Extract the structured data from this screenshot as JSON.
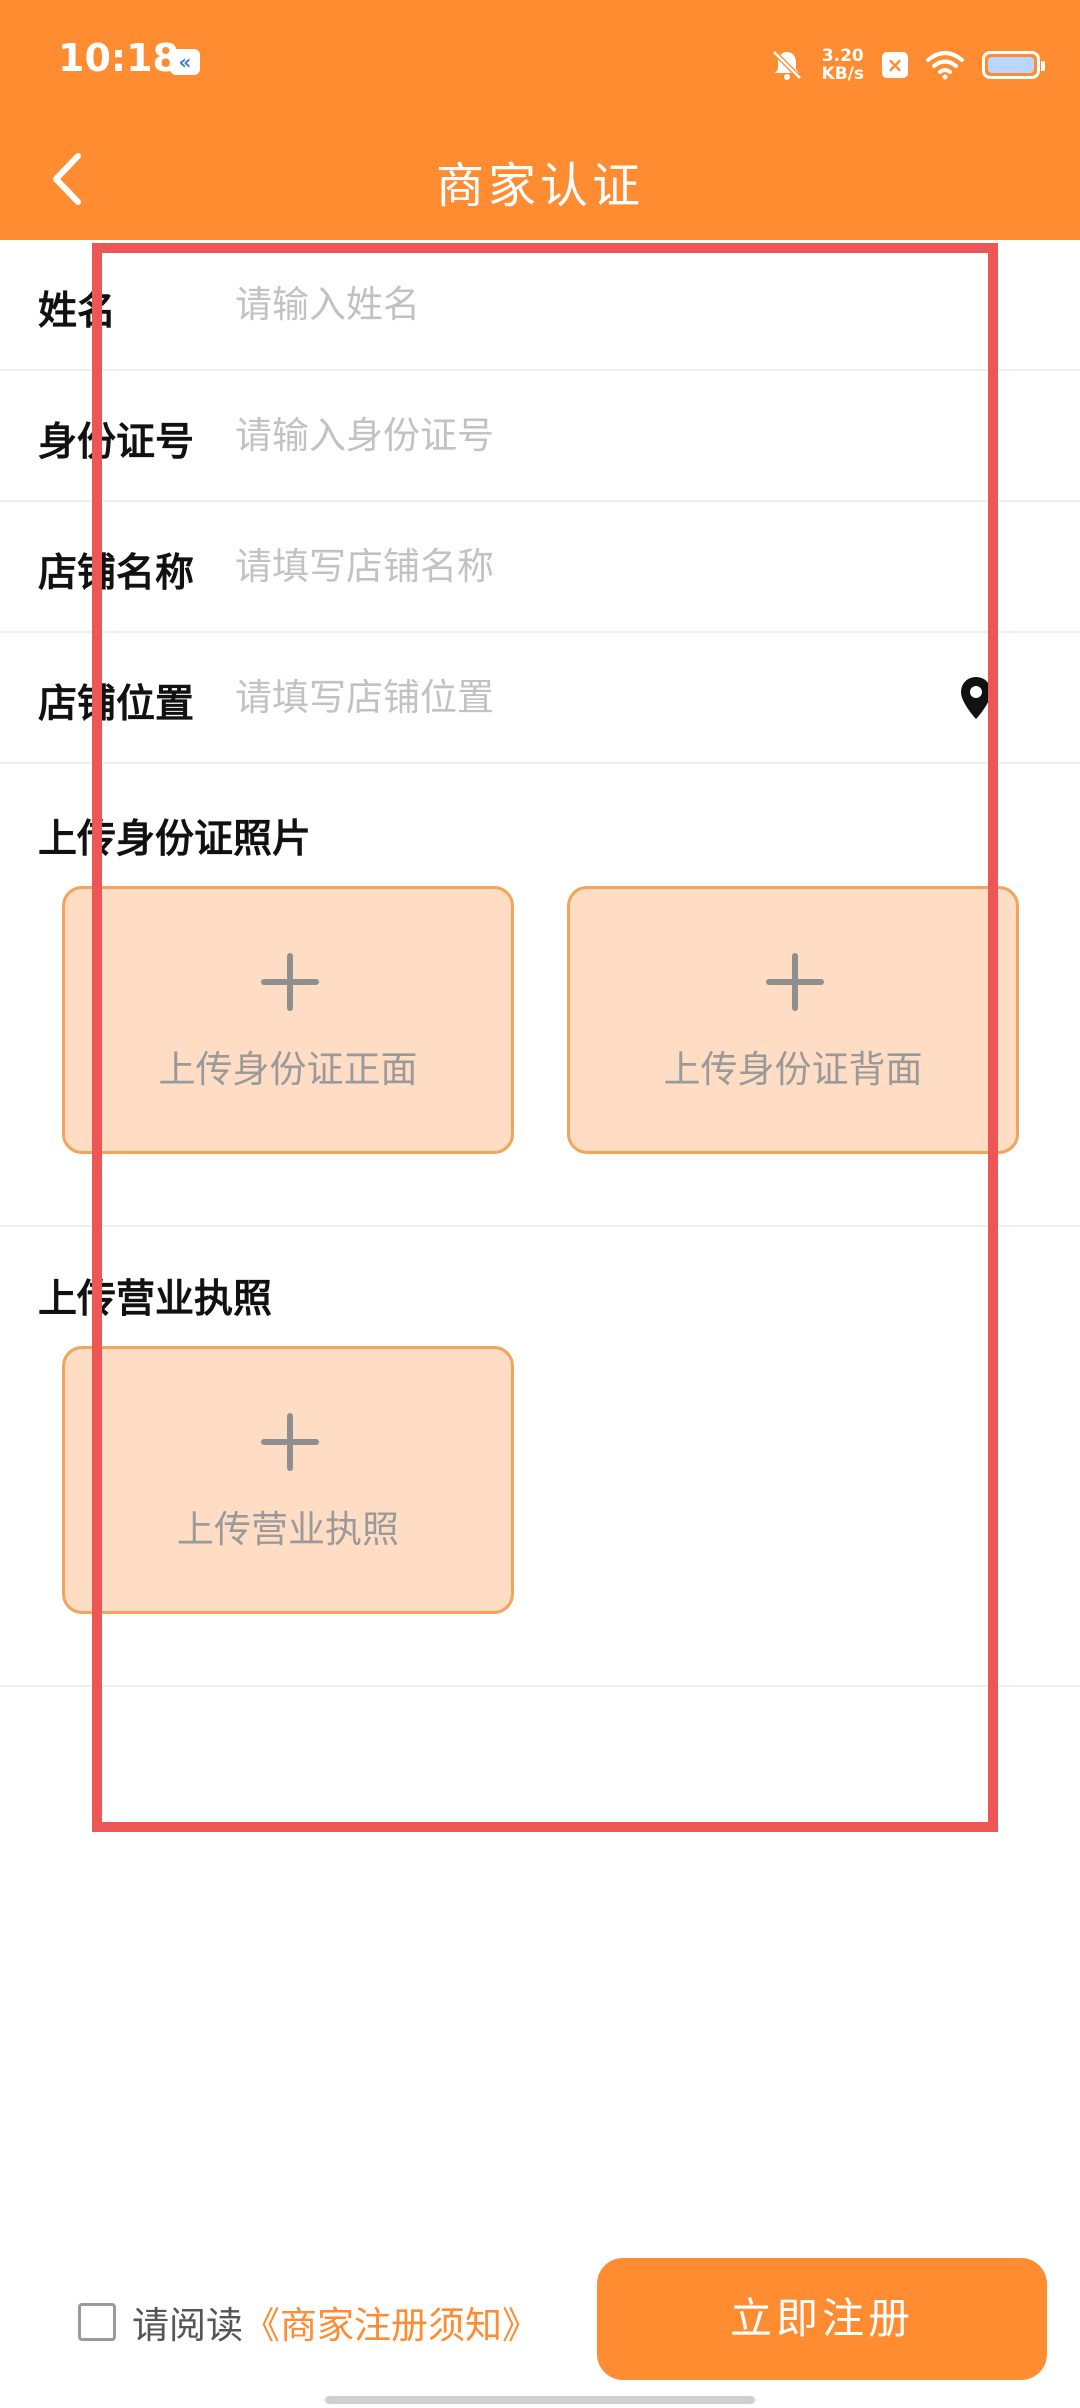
{
  "status_bar": {
    "time": "10:18",
    "net_speed_value": "3.20",
    "net_speed_unit": "KB/s",
    "icons": [
      "app-notification-icon",
      "bell-muted-icon",
      "close-badge-icon",
      "wifi-icon",
      "battery-icon"
    ]
  },
  "header": {
    "title": "商家认证",
    "back_icon": "chevron-left-icon",
    "background_color": "#FF8C31"
  },
  "form": {
    "fields": [
      {
        "label": "姓名",
        "placeholder": "请输入姓名",
        "value": ""
      },
      {
        "label": "身份证号",
        "placeholder": "请输入身份证号",
        "value": ""
      },
      {
        "label": "店铺名称",
        "placeholder": "请填写店铺名称",
        "value": ""
      },
      {
        "label": "店铺位置",
        "placeholder": "请填写店铺位置",
        "value": "",
        "icon": "location-pin-icon"
      }
    ]
  },
  "id_upload": {
    "title": "上传身份证照片",
    "front_label": "上传身份证正面",
    "back_label": "上传身份证背面"
  },
  "license_upload": {
    "title": "上传营业执照",
    "label": "上传营业执照"
  },
  "footer": {
    "agree_prefix": "请阅读",
    "agree_link": "《商家注册须知》",
    "agree_checked": false,
    "register_label": "立即注册"
  },
  "colors": {
    "accent": "#FF8C31",
    "upload_card_fill": "#FFDCC4",
    "upload_card_border": "#F2A55A",
    "annotation_frame": "#EE5555"
  }
}
